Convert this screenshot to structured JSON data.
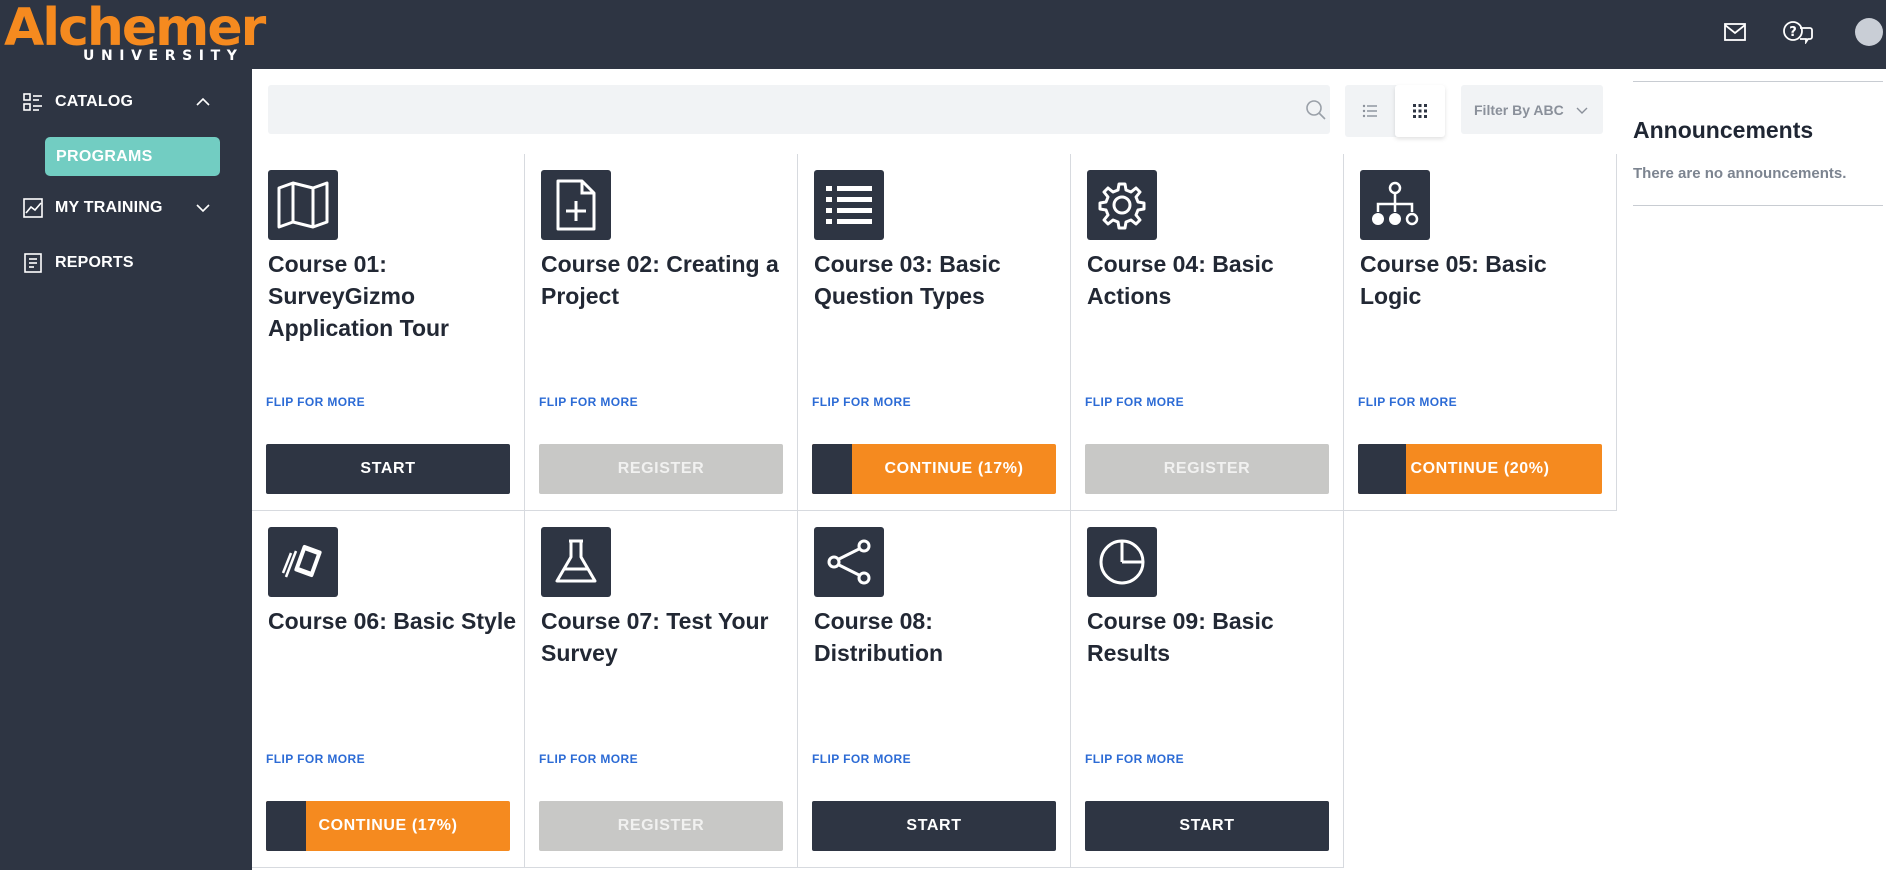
{
  "header": {
    "logo_main": "Alchemer",
    "logo_sub": "UNIVERSITY",
    "icons": [
      "mail-icon",
      "help-chat-icon",
      "avatar"
    ]
  },
  "sidebar": {
    "items": [
      {
        "label": "CATALOG",
        "icon": "catalog-icon",
        "expanded": true
      },
      {
        "label": "PROGRAMS",
        "active": true
      },
      {
        "label": "MY TRAINING",
        "icon": "chart-icon",
        "expanded": false
      },
      {
        "label": "REPORTS",
        "icon": "report-icon"
      }
    ]
  },
  "toolbar": {
    "search_placeholder": "",
    "filter_label": "Filter By ABC",
    "view_modes": [
      "list-view",
      "grid-view"
    ],
    "active_view": "grid-view"
  },
  "announcements": {
    "title": "Announcements",
    "empty_text": "There are no announcements."
  },
  "courses": [
    {
      "title": "Course 01: SurveyGizmo Application Tour",
      "icon": "map-icon",
      "flip": "FLIP FOR MORE",
      "button": "START",
      "state": "start"
    },
    {
      "title": "Course 02: Creating a Project",
      "icon": "file-plus-icon",
      "flip": "FLIP FOR MORE",
      "button": "REGISTER",
      "state": "register"
    },
    {
      "title": "Course 03: Basic Question Types",
      "icon": "list-icon",
      "flip": "FLIP FOR MORE",
      "button": "CONTINUE (17%)",
      "state": "continue",
      "progress": 0.17
    },
    {
      "title": "Course 04: Basic Actions",
      "icon": "gear-icon",
      "flip": "FLIP FOR MORE",
      "button": "REGISTER",
      "state": "register"
    },
    {
      "title": "Course 05: Basic Logic",
      "icon": "sitemap-icon",
      "flip": "FLIP FOR MORE",
      "button": "CONTINUE (20%)",
      "state": "continue",
      "progress": 0.2
    },
    {
      "title": "Course 06: Basic Style",
      "icon": "swatch-icon",
      "flip": "FLIP FOR MORE",
      "button": "CONTINUE (17%)",
      "state": "continue",
      "progress": 0.17
    },
    {
      "title": "Course 07: Test Your Survey",
      "icon": "flask-icon",
      "flip": "FLIP FOR MORE",
      "button": "REGISTER",
      "state": "register"
    },
    {
      "title": "Course 08: Distribution",
      "icon": "share-icon",
      "flip": "FLIP FOR MORE",
      "button": "START",
      "state": "start"
    },
    {
      "title": "Course 09: Basic Results",
      "icon": "pie-chart-icon",
      "flip": "FLIP FOR MORE",
      "button": "START",
      "state": "start"
    }
  ],
  "colors": {
    "nav_bg": "#2e3543",
    "accent_orange": "#f58a1f",
    "active_teal": "#72cdc2",
    "link_blue": "#2c6bd5",
    "disabled_gray": "#c8c8c6"
  }
}
